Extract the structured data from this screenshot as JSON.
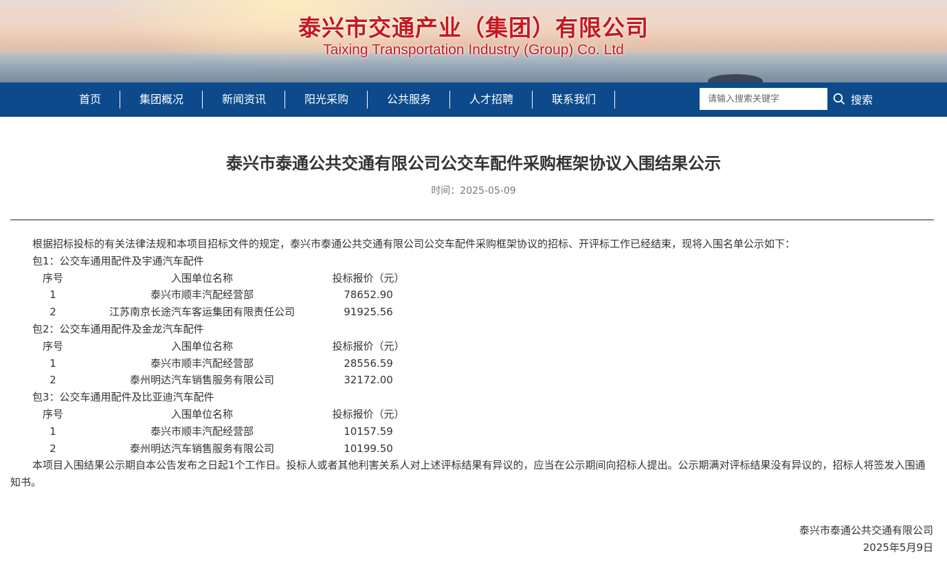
{
  "banner": {
    "title_cn": "泰兴市交通产业（集团）有限公司",
    "title_en": "Taixing Transportation Industry (Group) Co. Ltd"
  },
  "nav": {
    "items": [
      "首页",
      "集团概况",
      "新闻资讯",
      "阳光采购",
      "公共服务",
      "人才招聘",
      "联系我们"
    ],
    "search_placeholder": "请输入搜索关键字",
    "search_label": "搜索"
  },
  "article": {
    "title": "泰兴市泰通公共交通有限公司公交车配件采购框架协议入围结果公示",
    "meta": "时间：2025-05-09",
    "intro": "根据招标投标的有关法律法规和本项目招标文件的规定，泰兴市泰通公共交通有限公司公交车配件采购框架协议的招标、开评标工作已经结束，现将入围名单公示如下：",
    "headers": {
      "no": "序号",
      "name": "入围单位名称",
      "price": "投标报价（元）"
    },
    "packages": [
      {
        "title": "包1：公交车通用配件及宇通汽车配件",
        "rows": [
          {
            "no": "1",
            "name": "泰兴市顺丰汽配经营部",
            "price": "78652.90"
          },
          {
            "no": "2",
            "name": "江苏南京长途汽车客运集团有限责任公司",
            "price": "91925.56"
          }
        ]
      },
      {
        "title": "包2：公交车通用配件及金龙汽车配件",
        "rows": [
          {
            "no": "1",
            "name": "泰兴市顺丰汽配经营部",
            "price": "28556.59"
          },
          {
            "no": "2",
            "name": "泰州明达汽车销售服务有限公司",
            "price": "32172.00"
          }
        ]
      },
      {
        "title": "包3：公交车通用配件及比亚迪汽车配件",
        "rows": [
          {
            "no": "1",
            "name": "泰兴市顺丰汽配经营部",
            "price": "10157.59"
          },
          {
            "no": "2",
            "name": "泰州明达汽车销售服务有限公司",
            "price": "10199.50"
          }
        ]
      }
    ],
    "closing": "本项目入围结果公示期自本公告发布之日起1个工作日。投标人或者其他利害关系人对上述评标结果有异议的，应当在公示期间向招标人提出。公示期满对评标结果没有异议的，招标人将签发入围通知书。",
    "signature_org": "泰兴市泰通公共交通有限公司",
    "signature_date": "2025年5月9日"
  }
}
